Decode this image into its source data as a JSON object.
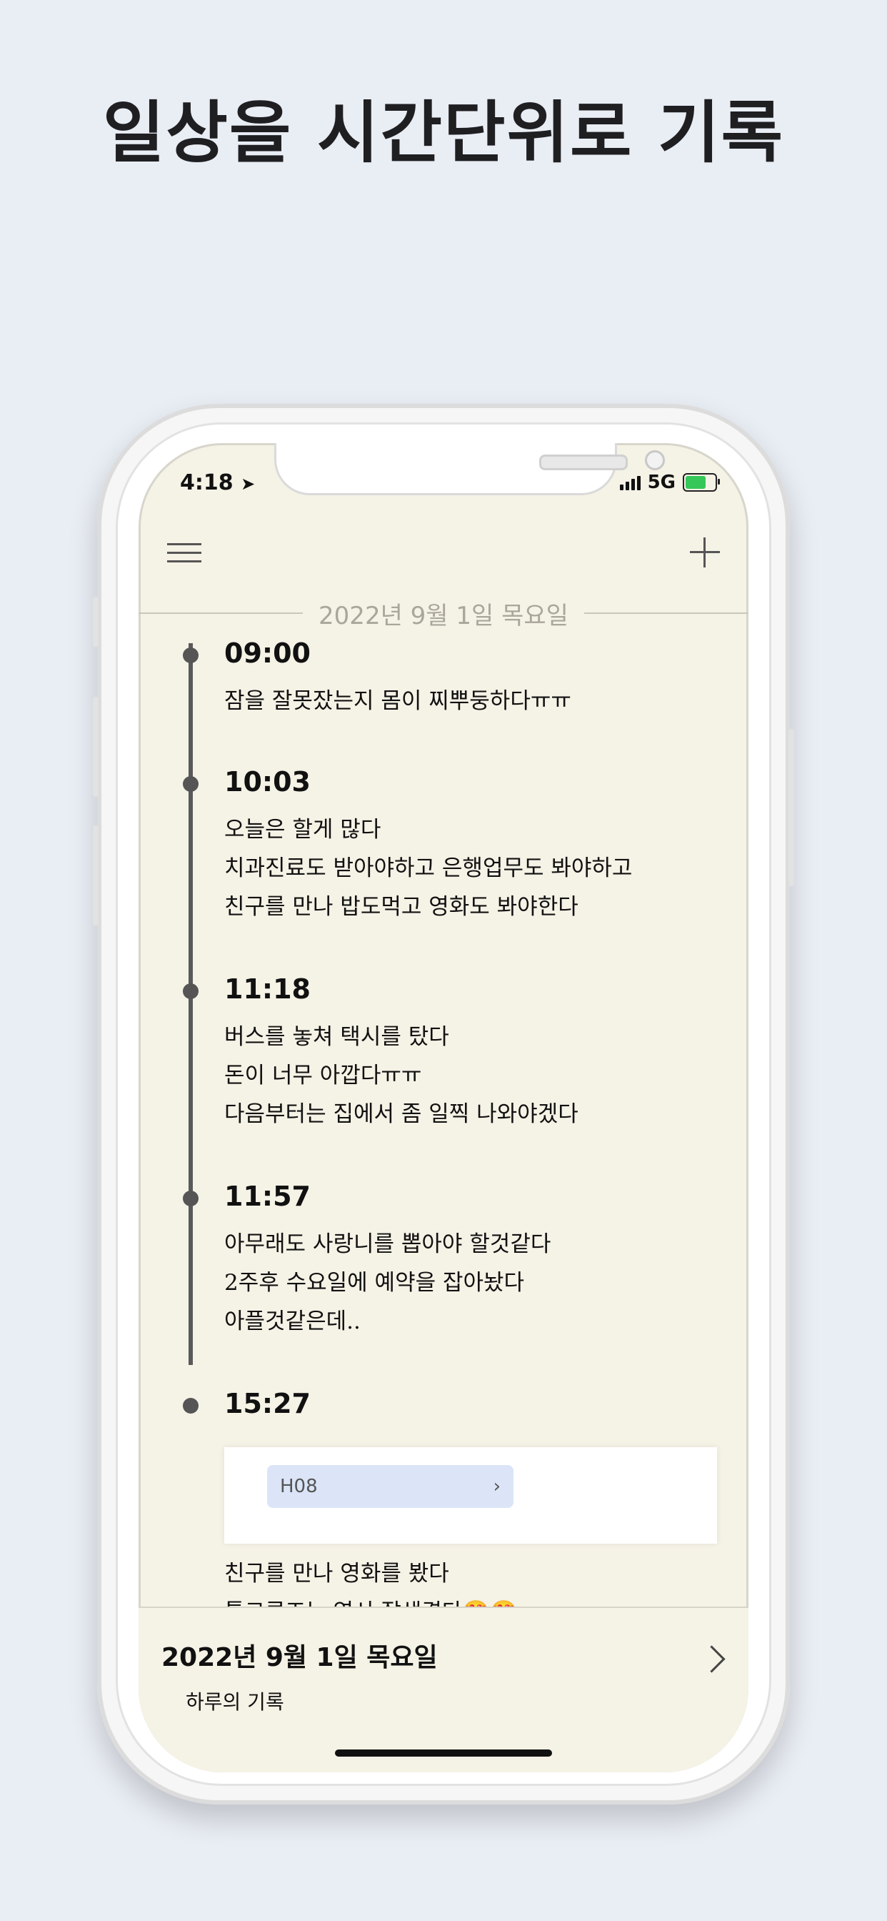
{
  "headline": "일상을 시간단위로 기록",
  "status_bar": {
    "time": "4:18",
    "network": "5G"
  },
  "header": {
    "date": "2022년 9월 1일 목요일"
  },
  "entries": [
    {
      "time": "09:00",
      "lines": [
        "잠을 잘못잤는지 몸이 찌뿌둥하다ㅠㅠ"
      ]
    },
    {
      "time": "10:03",
      "lines": [
        "오늘은 할게 많다",
        "치과진료도 받아야하고 은행업무도 봐야하고",
        "친구를 만나 밥도먹고 영화도 봐야한다"
      ]
    },
    {
      "time": "11:18",
      "lines": [
        "버스를 놓쳐 택시를 탔다",
        "돈이 너무 아깝다ㅠㅠ",
        "다음부터는 집에서 좀 일찍 나와야겠다"
      ]
    },
    {
      "time": "11:57",
      "lines": [
        "아무래도 사랑니를 뽑아야 할것같다",
        "2주후 수요일에 예약을 잡아놨다",
        "아플것같은데.."
      ]
    },
    {
      "time": "15:27",
      "image_label": "H08",
      "lines": [
        "친구를 만나 영화를 봤다",
        "톰크루즈는 역시 잘생겼다😍😍"
      ]
    }
  ],
  "bottom": {
    "date": "2022년 9월 1일 목요일",
    "subtitle": "하루의 기록"
  }
}
